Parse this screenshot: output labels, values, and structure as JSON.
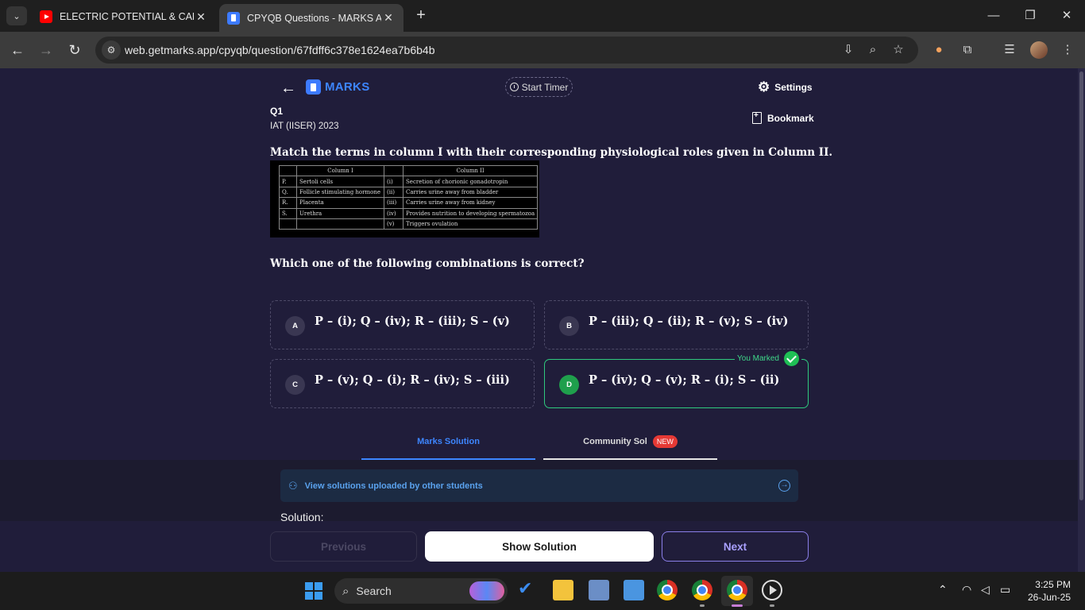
{
  "browser": {
    "tabs": [
      {
        "title": "ELECTRIC POTENTIAL & CAPACI",
        "favicon": "youtube-icon",
        "active": false
      },
      {
        "title": "CPYQB Questions - MARKS App",
        "favicon": "marks-app-icon",
        "active": true
      }
    ],
    "url": "web.getmarks.app/cpyqb/question/67fdff6c378e1624ea7b6b4b"
  },
  "header": {
    "logo_text": "MARKS",
    "start_timer": "Start Timer",
    "settings": "Settings"
  },
  "question": {
    "number": "Q1",
    "exam": "IAT (IISER) 2023",
    "bookmark": "Bookmark",
    "text": "Match the terms in column I with their corresponding physiological roles given in Column II.",
    "sub_text": "Which one of the following combinations is correct?",
    "table": {
      "col1_header": "Column I",
      "col2_header": "Column II",
      "rows": [
        {
          "k1": "P.",
          "v1": "Sertoli cells",
          "k2": "(i)",
          "v2": "Secretion of chorionic gonadotropin"
        },
        {
          "k1": "Q.",
          "v1": "Follicle stimulating hormone",
          "k2": "(ii)",
          "v2": "Carries urine away from bladder"
        },
        {
          "k1": "R.",
          "v1": "Placenta",
          "k2": "(iii)",
          "v2": "Carries urine away from kidney"
        },
        {
          "k1": "S.",
          "v1": "Urethra",
          "k2": "(iv)",
          "v2": "Provides nutrition to developing spermatozoa"
        },
        {
          "k1": "",
          "v1": "",
          "k2": "(v)",
          "v2": "Triggers ovulation"
        }
      ]
    }
  },
  "options": [
    {
      "letter": "A",
      "text": "P – (i); Q – (iv); R – (iii); S – (v)"
    },
    {
      "letter": "B",
      "text": "P – (iii); Q – (ii); R – (v); S – (iv)"
    },
    {
      "letter": "C",
      "text": "P – (v); Q – (i); R – (iv); S – (iii)"
    },
    {
      "letter": "D",
      "text": "P – (iv); Q – (v); R – (i); S – (ii)"
    }
  ],
  "marked_label": "You Marked",
  "solution_tabs": {
    "marks": "Marks Solution",
    "community": "Community Sol",
    "new_badge": "NEW"
  },
  "community_banner": "View solutions uploaded by other students",
  "solution_label": "Solution:",
  "buttons": {
    "previous": "Previous",
    "show_solution": "Show Solution",
    "next": "Next"
  },
  "taskbar": {
    "search": "Search",
    "time": "3:25 PM",
    "date": "26-Jun-25"
  },
  "colors": {
    "accent": "#3d86ff",
    "correct": "#2fc97e",
    "page_bg": "#201d3a"
  }
}
